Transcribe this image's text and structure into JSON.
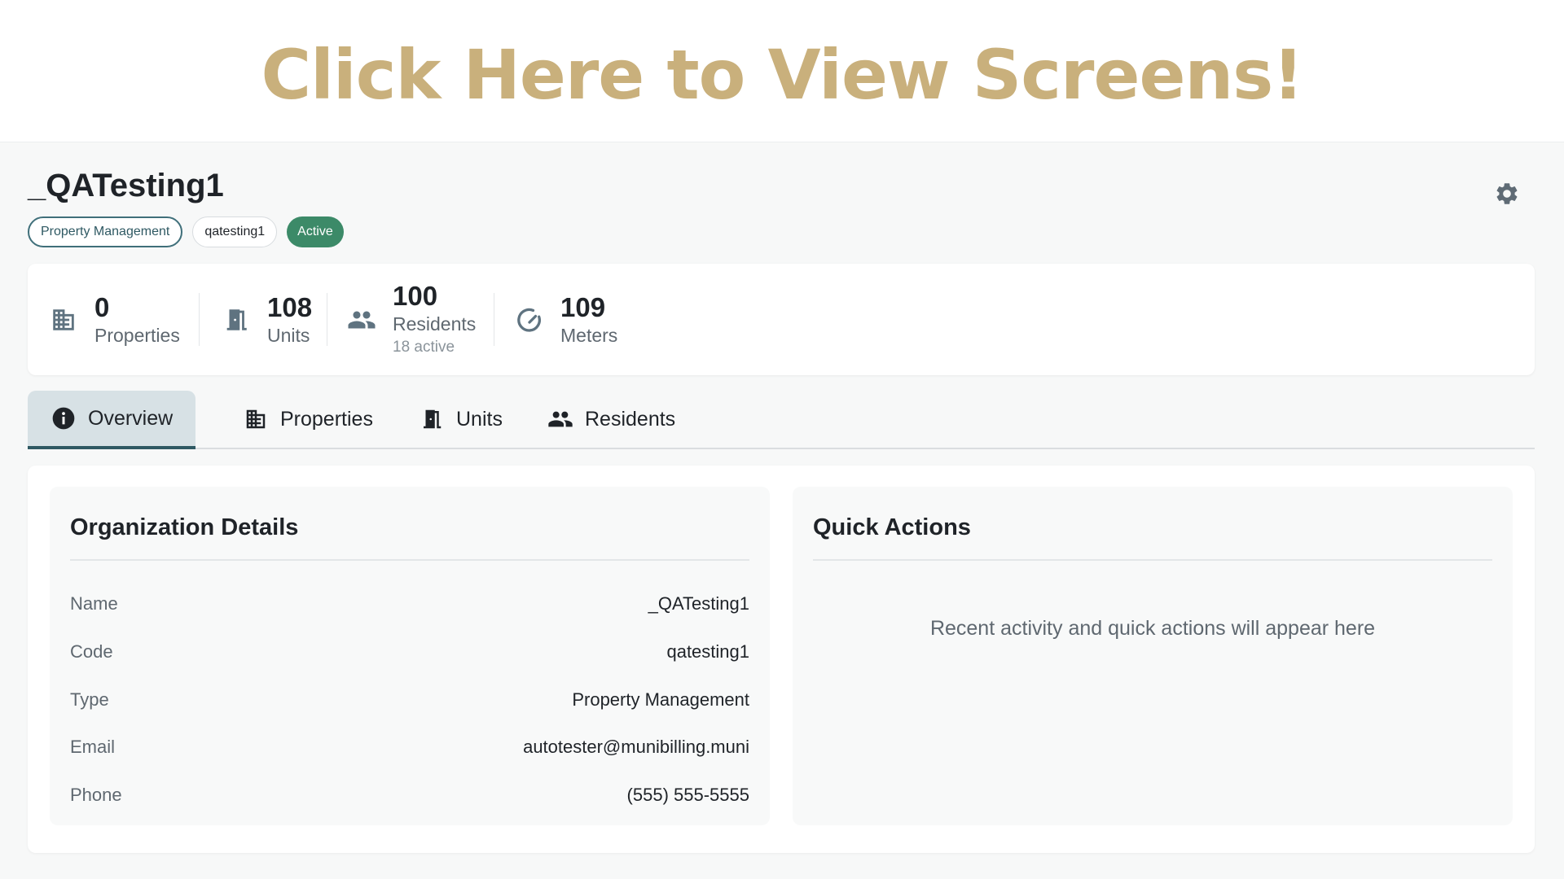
{
  "banner": {
    "text": "Click Here to View Screens!"
  },
  "header": {
    "title": "_QATesting1",
    "badges": {
      "type": "Property Management",
      "code": "qatesting1",
      "status": "Active"
    }
  },
  "icons": {
    "settings": "gear-icon",
    "properties": "building-icon",
    "units": "door-icon",
    "residents": "people-icon",
    "meters": "gauge-icon",
    "overview": "info-icon"
  },
  "colors": {
    "banner_text": "#c9b07c",
    "accent": "#2f5963",
    "status_active": "#3c8a68",
    "active_tab_bg": "#d7e1e5",
    "icon_gray": "#5f7380"
  },
  "stats": {
    "properties": {
      "value": "0",
      "label": "Properties"
    },
    "units": {
      "value": "108",
      "label": "Units"
    },
    "residents": {
      "value": "100",
      "label": "Residents",
      "sub": "18 active"
    },
    "meters": {
      "value": "109",
      "label": "Meters"
    }
  },
  "tabs": [
    {
      "label": "Overview",
      "active": true
    },
    {
      "label": "Properties",
      "active": false
    },
    {
      "label": "Units",
      "active": false
    },
    {
      "label": "Residents",
      "active": false
    }
  ],
  "org_details": {
    "title": "Organization Details",
    "rows": [
      {
        "label": "Name",
        "value": "_QATesting1"
      },
      {
        "label": "Code",
        "value": "qatesting1"
      },
      {
        "label": "Type",
        "value": "Property Management"
      },
      {
        "label": "Email",
        "value": "autotester@munibilling.muni"
      },
      {
        "label": "Phone",
        "value": "(555) 555-5555"
      }
    ]
  },
  "quick_actions": {
    "title": "Quick Actions",
    "message": "Recent activity and quick actions will appear here"
  }
}
